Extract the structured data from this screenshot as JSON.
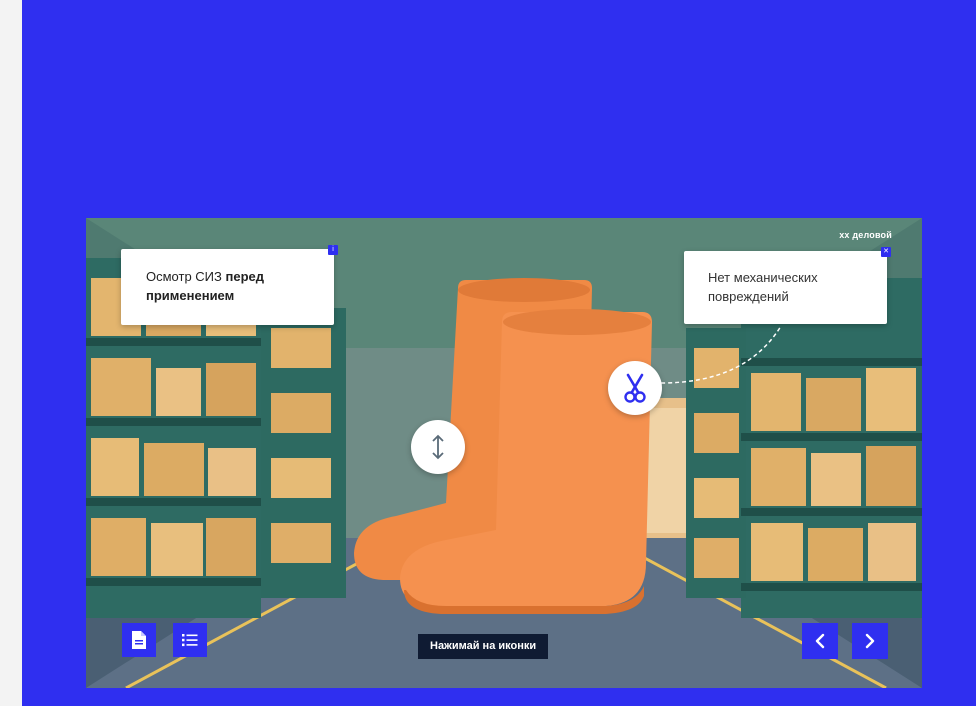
{
  "brand": {
    "logo_text": "хх деловой"
  },
  "callouts": {
    "left": {
      "text_regular": "Осмотр СИЗ ",
      "text_bold": "перед применением",
      "corner_icon": "info-icon"
    },
    "right": {
      "text": "Нет механических повреждений",
      "corner_icon": "close-icon"
    }
  },
  "hotspots": [
    {
      "name": "vertical-arrows-hotspot",
      "icon": "vertical-arrows-icon"
    },
    {
      "name": "scissors-hotspot",
      "icon": "scissors-icon"
    }
  ],
  "hint": {
    "text": "Нажимай на иконки"
  },
  "toolbar": {
    "left_buttons": [
      {
        "name": "document-button",
        "icon": "document-icon"
      },
      {
        "name": "list-button",
        "icon": "list-icon"
      }
    ],
    "nav_buttons": [
      {
        "name": "previous-button",
        "icon": "chevron-left-icon"
      },
      {
        "name": "next-button",
        "icon": "chevron-right-icon"
      }
    ]
  },
  "colors": {
    "accent": "#2f2ff0",
    "boot": "#f28c4a",
    "hint_bg": "#0f1b33",
    "callout_bg": "#ffffff"
  }
}
